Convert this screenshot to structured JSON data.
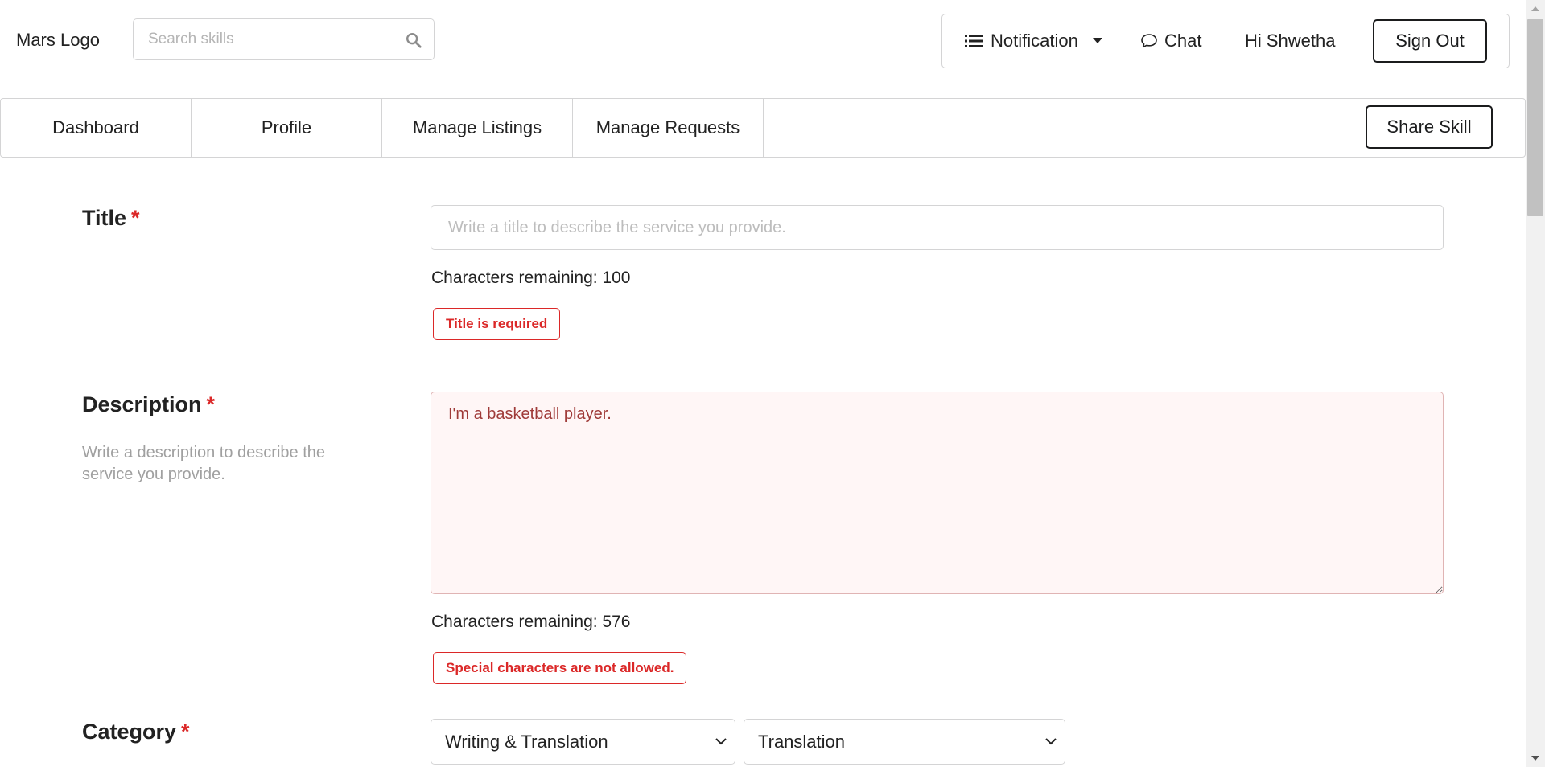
{
  "header": {
    "logo_text": "Mars Logo",
    "search_placeholder": "Search skills",
    "search_icon": "search-icon",
    "notification_label": "Notification",
    "chat_label": "Chat",
    "greeting": "Hi Shwetha",
    "signout_label": "Sign Out"
  },
  "nav": {
    "items": [
      {
        "label": "Dashboard"
      },
      {
        "label": "Profile"
      },
      {
        "label": "Manage Listings"
      },
      {
        "label": "Manage Requests"
      }
    ],
    "share_skill_label": "Share Skill"
  },
  "form": {
    "title": {
      "label": "Title",
      "required_mark": "*",
      "placeholder": "Write a title to describe the service you provide.",
      "value": "",
      "counter": "Characters remaining: 100",
      "error": "Title is required"
    },
    "description": {
      "label": "Description",
      "required_mark": "*",
      "hint": "Write a description to describe the service you provide.",
      "value": "I'm a basketball player.",
      "counter": "Characters remaining: 576",
      "error": "Special characters are not allowed."
    },
    "category": {
      "label": "Category",
      "required_mark": "*",
      "selected_category": "Writing & Translation",
      "selected_subcategory": "Translation"
    }
  },
  "colors": {
    "error": "#db2828",
    "error_bg": "#fff6f6",
    "border": "#d4d4d5"
  }
}
